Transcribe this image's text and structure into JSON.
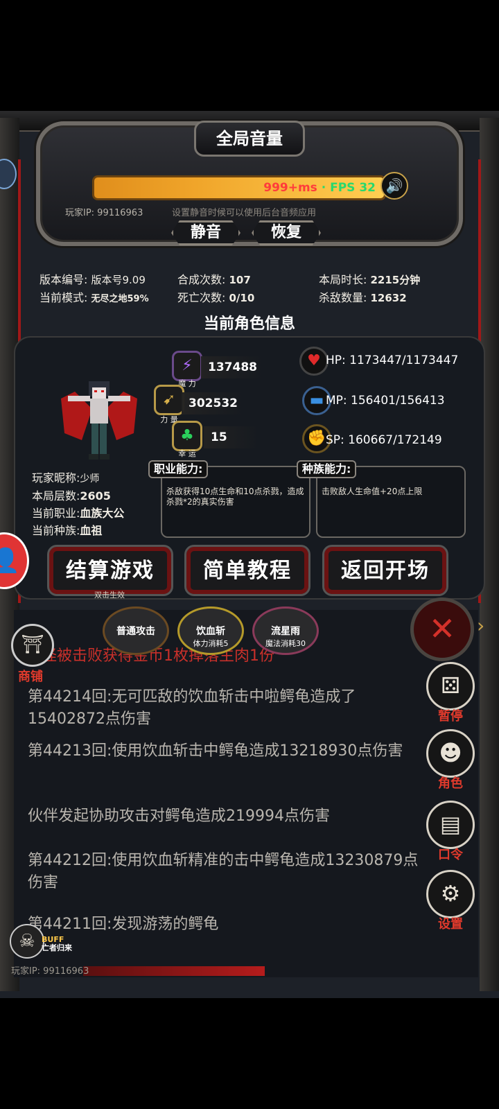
{
  "volume_panel": {
    "title": "全局音量",
    "latency": "999+ms",
    "fps": "FPS 32",
    "player_ip_label": "玩家IP: 99116963",
    "hint": "设置静音时候可以使用后台音频应用",
    "mute_label": "静音",
    "restore_label": "恢复",
    "speaker_icon": "speaker-icon"
  },
  "stats": {
    "version_label": "版本编号:",
    "version_value": "版本号9.09",
    "mode_label": "当前模式:",
    "mode_value": "无尽之地59%",
    "craft_label": "合成次数:",
    "craft_value": "107",
    "death_label": "死亡次数:",
    "death_value": "0/10",
    "duration_label": "本局时长:",
    "duration_value": "2215分钟",
    "kills_label": "杀敌数量:",
    "kills_value": "12632"
  },
  "character": {
    "section_title": "当前角色信息",
    "magic_value": "137488",
    "magic_caption": "魔 力",
    "strength_value": "302532",
    "strength_caption": "力 量",
    "luck_value": "15",
    "luck_caption": "幸 运",
    "hp": "HP:  1173447/1173447",
    "mp": "MP:  156401/156413",
    "sp": "SP:  160667/172149",
    "nickname_label": "玩家昵称:",
    "nickname_value": "少师",
    "floor_label": "本局层数:",
    "floor_value": "2605",
    "job_label": "当前职业:",
    "job_value": "血族大公",
    "race_label": "当前种族:",
    "race_value": "血祖",
    "job_ability_title": "职业能力:",
    "job_ability_desc": "杀敌获得10点生命和10点杀戮，造成杀戮*2的真实伤害",
    "race_ability_title": "种族能力:",
    "race_ability_desc": "击败敌人生命值+20点上限"
  },
  "actions": {
    "settle_label": "结算游戏",
    "settle_hint": "双击生效",
    "tutorial_label": "简单教程",
    "return_label": "返回开场"
  },
  "skills": [
    {
      "name": "普通攻击",
      "sub": ""
    },
    {
      "name": "饮血斩",
      "sub": "体力消耗5"
    },
    {
      "name": "流星雨",
      "sub": "魔法消耗30"
    }
  ],
  "log": {
    "partial_top": "怪被击败获得金币1枚掉落生肉1份",
    "lines": [
      "第44214回:无可匹敌的饮血斩击中啦鳄龟造成了15402872点伤害",
      "第44213回:使用饮血斩击中鳄龟造成13218930点伤害",
      "伙伴发起协助攻击对鳄龟造成219994点伤害",
      "第44212回:使用饮血斩精准的击中鳄龟造成13230879点伤害",
      "第44211回:发现游荡的鳄龟"
    ]
  },
  "side_menu": {
    "shop": "商铺",
    "pause": "暂停",
    "role": "角色",
    "password": "口令",
    "settings": "设置"
  },
  "buff": {
    "label": "BUFF",
    "sub": "亡者归来"
  },
  "footer_ip": "玩家IP:  99116963"
}
